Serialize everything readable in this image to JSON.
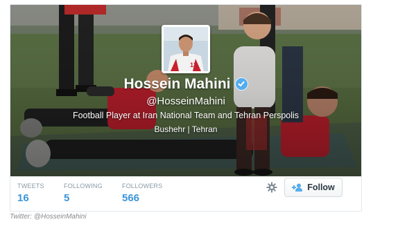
{
  "profile": {
    "name": "Hossein Mahini",
    "handle": "@HosseinMahini",
    "bio": "Football Player at Iran National Team and Tehran Perspolis",
    "location": "Bushehr | Tehran",
    "verified": true,
    "jersey_number": "13"
  },
  "stats": [
    {
      "label": "TWEETS",
      "value": "16"
    },
    {
      "label": "FOLLOWING",
      "value": "5"
    },
    {
      "label": "FOLLOWERS",
      "value": "566"
    }
  ],
  "actions": {
    "follow_label": "Follow",
    "settings_icon": "gear-icon",
    "follow_icon": "add-user-icon"
  },
  "caption": "Twitter: @HosseinMahini",
  "colors": {
    "stat_value": "#3b94d9",
    "stat_label": "#8899a6",
    "verified": "#55acee",
    "jersey_red": "#c8202c"
  }
}
